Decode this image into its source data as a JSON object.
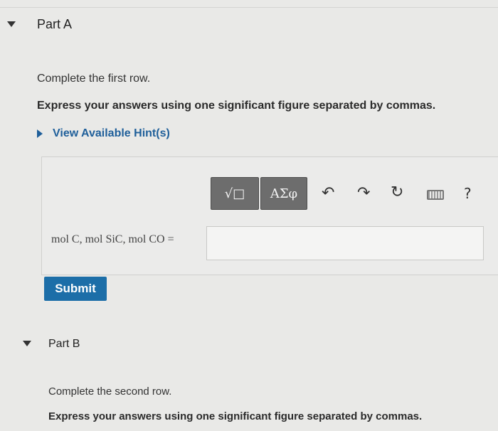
{
  "partA": {
    "title": "Part A",
    "prompt": "Complete the first row.",
    "instruction": "Express your answers using one significant figure separated by commas.",
    "hint_link": "View Available Hint(s)",
    "toolbar": {
      "templates_label": "√□",
      "greek_label": "ΑΣφ",
      "undo_icon": "undo-icon",
      "redo_icon": "redo-icon",
      "reset_icon": "reset-icon",
      "keyboard_icon": "keyboard-icon",
      "help_label": "?"
    },
    "answer_label": "mol C, mol SiC, mol CO =",
    "answer_value": "",
    "submit_label": "Submit"
  },
  "partB": {
    "title": "Part B",
    "prompt": "Complete the second row.",
    "instruction": "Express your answers using one significant figure separated by commas."
  },
  "colors": {
    "accent": "#1c6ea8",
    "link": "#1f5f9a",
    "toolbar_button": "#6d6d6d"
  }
}
